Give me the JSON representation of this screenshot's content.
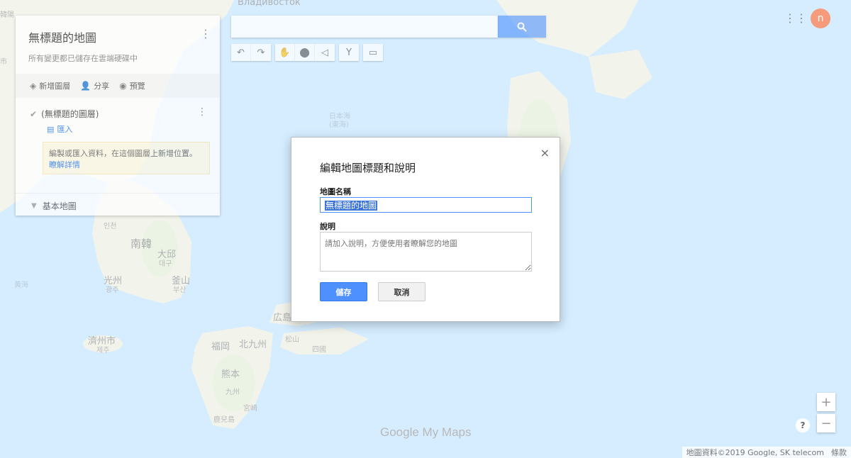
{
  "panel": {
    "title": "無標題的地圖",
    "subtitle": "所有變更都已儲存在雲端硬碟中",
    "actions": [
      {
        "label": "新增圖層",
        "icon": "layers-icon"
      },
      {
        "label": "分享",
        "icon": "add-person-icon"
      },
      {
        "label": "預覽",
        "icon": "eye-icon"
      }
    ],
    "layer_name": "(無標題的圖層)",
    "import_label": "匯入",
    "hint_text": "編製或匯入資料，在這個圖層上新增位置。",
    "hint_link": "瞭解詳情",
    "basemap_label": "基本地圖"
  },
  "toolbar": {
    "tools": [
      "undo-icon",
      "redo-icon",
      "hand-icon",
      "marker-icon",
      "draw-line-icon",
      "directions-icon",
      "ruler-icon"
    ]
  },
  "user": {
    "avatar_letter": "n"
  },
  "map_labels": {
    "vladivostok": "Владивосток",
    "sea_of_japan": "日本海",
    "sea_of_japan_2": "(東海)",
    "south_korea": "南韓",
    "daegu": "大邱",
    "daegu_kr": "대구",
    "gwangju": "光州",
    "gwangju_kr": "광주",
    "busan": "釜山",
    "busan_kr": "부산",
    "jeju": "濟州市",
    "jeju_kr": "제주",
    "incheon_kr": "인천",
    "yellow_sea": "黃海",
    "fukuoka": "福岡",
    "kitakyushu": "北九州",
    "kumamoto": "熊本",
    "kyushu": "九州",
    "miyazaki": "宮崎",
    "kagoshima": "鹿兒島",
    "shikoku": "四國",
    "matsuyama": "松山",
    "hiroshima": "広島",
    "top_left_1": "韓陽",
    "top_left_2": "市"
  },
  "dialog": {
    "title": "編輯地圖標題和說明",
    "name_label": "地圖名稱",
    "name_value": "無標題的地圖",
    "desc_label": "說明",
    "desc_placeholder": "請加入說明，方便使用者瞭解您的地圖",
    "save_label": "儲存",
    "cancel_label": "取消",
    "close_glyph": "×"
  },
  "zoom": {
    "plus": "+",
    "minus": "−",
    "help": "?"
  },
  "footer": {
    "logo_text": "Google My Maps",
    "attribution": "地圖資料©2019 Google, SK telecom",
    "terms": "條款"
  },
  "colors": {
    "sea": "#aadaff",
    "land": "#eef0e6",
    "primary_blue": "#4d90fe",
    "avatar": "#f59a7a"
  }
}
